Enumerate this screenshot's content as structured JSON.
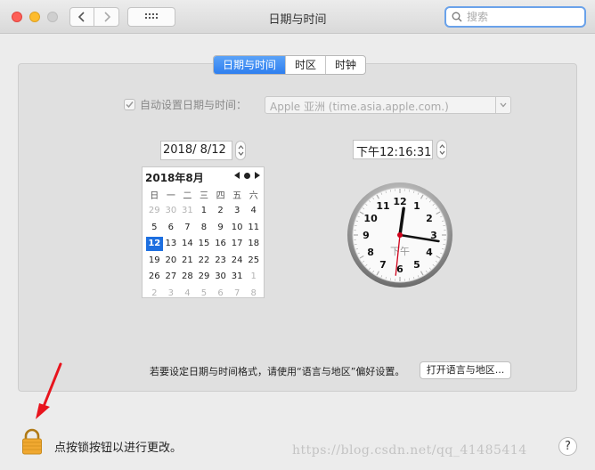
{
  "window": {
    "title": "日期与时间"
  },
  "search": {
    "placeholder": "搜索"
  },
  "tabs": [
    {
      "label": "日期与时间",
      "active": true
    },
    {
      "label": "时区",
      "active": false
    },
    {
      "label": "时钟",
      "active": false
    }
  ],
  "auto": {
    "label": "自动设置日期与时间：",
    "checked": true,
    "server": "Apple 亚洲 (time.asia.apple.com.)"
  },
  "date_value": "2018/  8/12",
  "time_value": "下午12:16:31",
  "calendar": {
    "title": "2018年8月",
    "weekdays": [
      "日",
      "一",
      "二",
      "三",
      "四",
      "五",
      "六"
    ],
    "weeks": [
      [
        "29",
        "30",
        "31",
        "1",
        "2",
        "3",
        "4"
      ],
      [
        "5",
        "6",
        "7",
        "8",
        "9",
        "10",
        "11"
      ],
      [
        "12",
        "13",
        "14",
        "15",
        "16",
        "17",
        "18"
      ],
      [
        "19",
        "20",
        "21",
        "22",
        "23",
        "24",
        "25"
      ],
      [
        "26",
        "27",
        "28",
        "29",
        "30",
        "31",
        "1"
      ],
      [
        "2",
        "3",
        "4",
        "5",
        "6",
        "7",
        "8"
      ]
    ],
    "today": "12"
  },
  "clock": {
    "numbers": [
      "12",
      "1",
      "2",
      "3",
      "4",
      "5",
      "6",
      "7",
      "8",
      "9",
      "10",
      "11"
    ],
    "period": "下午",
    "hour": 12,
    "minute": 16,
    "second": 31
  },
  "format": {
    "text": "若要设定日期与时间格式，请使用“语言与地区”偏好设置。",
    "button": "打开语言与地区..."
  },
  "lock": {
    "text": "点按锁按钮以进行更改。"
  },
  "help": {
    "label": "?"
  },
  "watermark": "https://blog.csdn.net/qq_41485414",
  "colors": {
    "accent": "#2f7fef",
    "second_hand": "#d0021b",
    "annotation_arrow": "#e8141d"
  }
}
